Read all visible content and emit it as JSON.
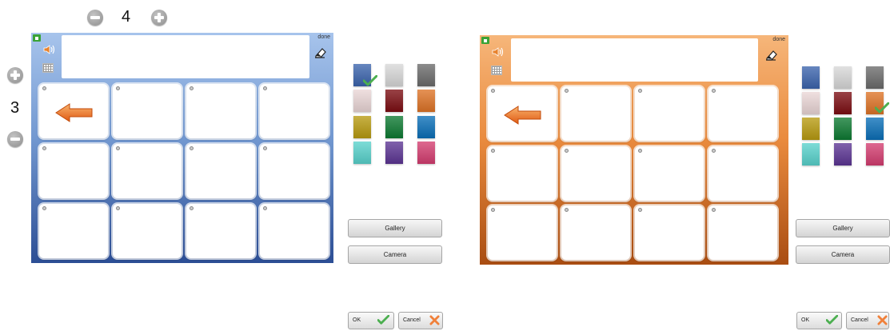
{
  "grid": {
    "columns": "4",
    "rows": "3"
  },
  "panels": [
    {
      "theme": "blue",
      "done_label": "done"
    },
    {
      "theme": "orange",
      "done_label": "done"
    }
  ],
  "colors": {
    "swatches": [
      "#3b64ad",
      "#d8d8d8",
      "#6b6b6b",
      "#ead6d6",
      "#7c0d12",
      "#de7326",
      "#b89b10",
      "#0d7a32",
      "#0a6fb8",
      "#58d2cc",
      "#5c3594",
      "#d43d70"
    ],
    "selected_left": "#3b64ad",
    "selected_right": "#de7326",
    "check": "#4caf50",
    "cancel_x": "#f0803a"
  },
  "icons": [
    "home-icon",
    "speaker-icon",
    "keyboard-icon",
    "eraser-icon",
    "arrow-left-icon",
    "plus-icon",
    "minus-icon",
    "check-icon",
    "close-icon"
  ],
  "buttons": {
    "gallery": "Gallery",
    "camera": "Camera",
    "ok": "OK",
    "cancel": "Cancel"
  }
}
